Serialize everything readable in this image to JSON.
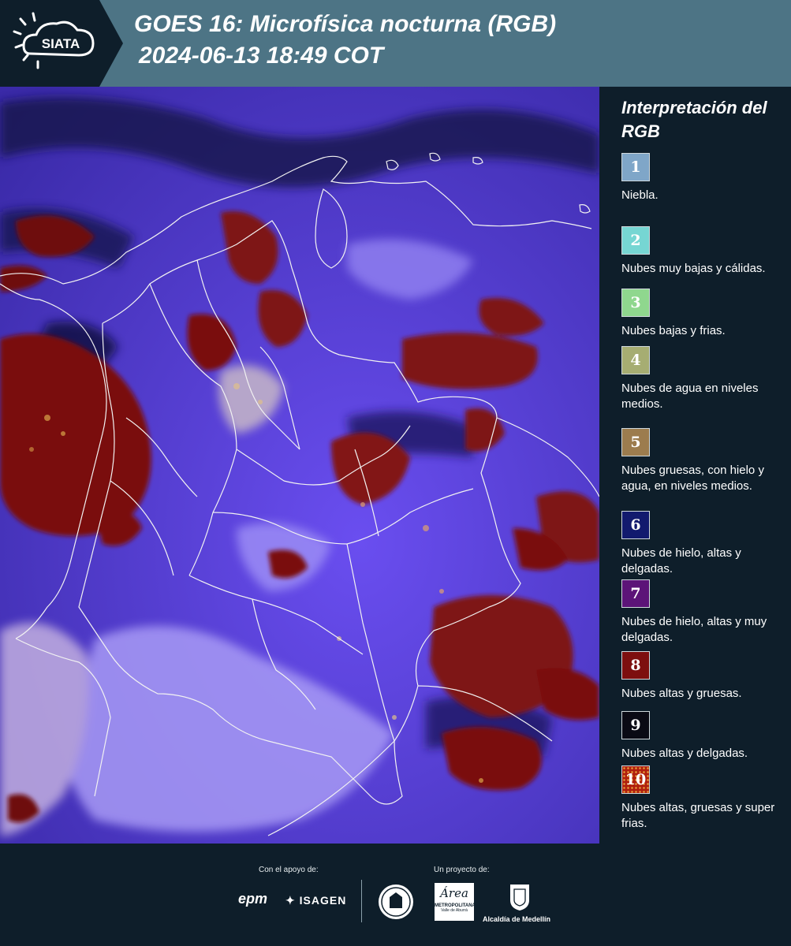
{
  "header": {
    "logo_text": "SIATA",
    "title_line1": "GOES 16: Microfísica nocturna (RGB)",
    "title_line2": "2024-06-13 18:49 COT"
  },
  "legend": {
    "title": "Interpretación del RGB",
    "items": [
      {
        "number": "1",
        "label": "Niebla.",
        "color": "#7fa6c8"
      },
      {
        "number": "2",
        "label": "Nubes muy bajas y cálidas.",
        "color": "#76d6d3"
      },
      {
        "number": "3",
        "label": "Nubes bajas y frias.",
        "color": "#8fd78e"
      },
      {
        "number": "4",
        "label": "Nubes de agua en niveles medios.",
        "color": "#a6ad72"
      },
      {
        "number": "5",
        "label": "Nubes gruesas, con hielo y agua, en niveles medios.",
        "color": "#9c7c4e"
      },
      {
        "number": "6",
        "label": "Nubes de hielo, altas y delgadas.",
        "color": "#121a6e"
      },
      {
        "number": "7",
        "label": "Nubes de hielo, altas y muy delgadas.",
        "color": "#5c1478"
      },
      {
        "number": "8",
        "label": "Nubes altas y gruesas.",
        "color": "#7d0f0f"
      },
      {
        "number": "9",
        "label": "Nubes altas y delgadas.",
        "color": "#0a0a14"
      },
      {
        "number": "10",
        "label": "Nubes altas, gruesas y super frias.",
        "color": "#b0200e"
      }
    ]
  },
  "footer": {
    "support_label": "Con el apoyo de:",
    "project_label": "Un proyecto de:",
    "sponsor_epm": "epm",
    "sponsor_isagen": "ISAGEN",
    "area_name": "Área",
    "area_sub": "METROPOLITANA",
    "area_sub2": "Valle de Aburrá",
    "alcaldia": "Alcaldía de Medellín"
  }
}
